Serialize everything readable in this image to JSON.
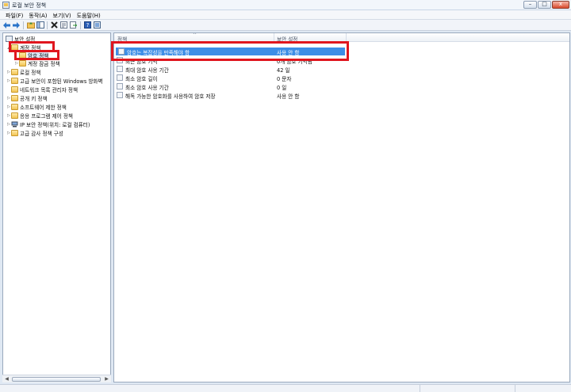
{
  "window": {
    "title": "로컬 보안 정책"
  },
  "window_buttons": {
    "minimize": "–",
    "maximize": "□",
    "close": "x"
  },
  "menubar": [
    {
      "label": "파일(F)"
    },
    {
      "label": "동작(A)"
    },
    {
      "label": "보기(V)"
    },
    {
      "label": "도움말(H)"
    }
  ],
  "toolbar": {
    "icons": [
      "back-arrow-icon",
      "forward-arrow-icon",
      "up-folder-icon",
      "show-hide-tree-icon",
      "delete-icon",
      "properties-icon",
      "export-list-icon",
      "help-icon",
      "console-icon"
    ]
  },
  "tree": {
    "root": "보안 설정",
    "items": [
      {
        "label": "계정 정책",
        "level": 1,
        "expanded": true
      },
      {
        "label": "암호 정책",
        "level": 2,
        "selected": true
      },
      {
        "label": "계정 잠금 정책",
        "level": 2
      },
      {
        "label": "로컬 정책",
        "level": 1
      },
      {
        "label": "고급 보안이 포함된 Windows 방화벽",
        "level": 1
      },
      {
        "label": "네트워크 목록 관리자 정책",
        "level": 1
      },
      {
        "label": "공개 키 정책",
        "level": 1
      },
      {
        "label": "소프트웨어 제한 정책",
        "level": 1
      },
      {
        "label": "응용 프로그램 제어 정책",
        "level": 1
      },
      {
        "label": "IP 보안 정책(위치: 로컬 컴퓨터)",
        "level": 1
      },
      {
        "label": "고급 감사 정책 구성",
        "level": 1
      }
    ]
  },
  "list": {
    "columns": [
      "정책",
      "보안 설정"
    ],
    "rows": [
      {
        "policy": "암호는 복잡성을 만족해야 함",
        "setting": "사용 안 함",
        "selected": true
      },
      {
        "policy": "최근 암호 기억",
        "setting": "0개 암호 기억됨"
      },
      {
        "policy": "최대 암호 사용 기간",
        "setting": "42 일"
      },
      {
        "policy": "최소 암호 길이",
        "setting": "0 문자"
      },
      {
        "policy": "최소 암호 사용 기간",
        "setting": "0 일"
      },
      {
        "policy": "해독 가능한 암호화를 사용하여 암호 저장",
        "setting": "사용 안 함"
      }
    ]
  },
  "colors": {
    "selection": "#3d8ee6",
    "highlight_box": "#e0161e",
    "folder": "#f2c453"
  }
}
